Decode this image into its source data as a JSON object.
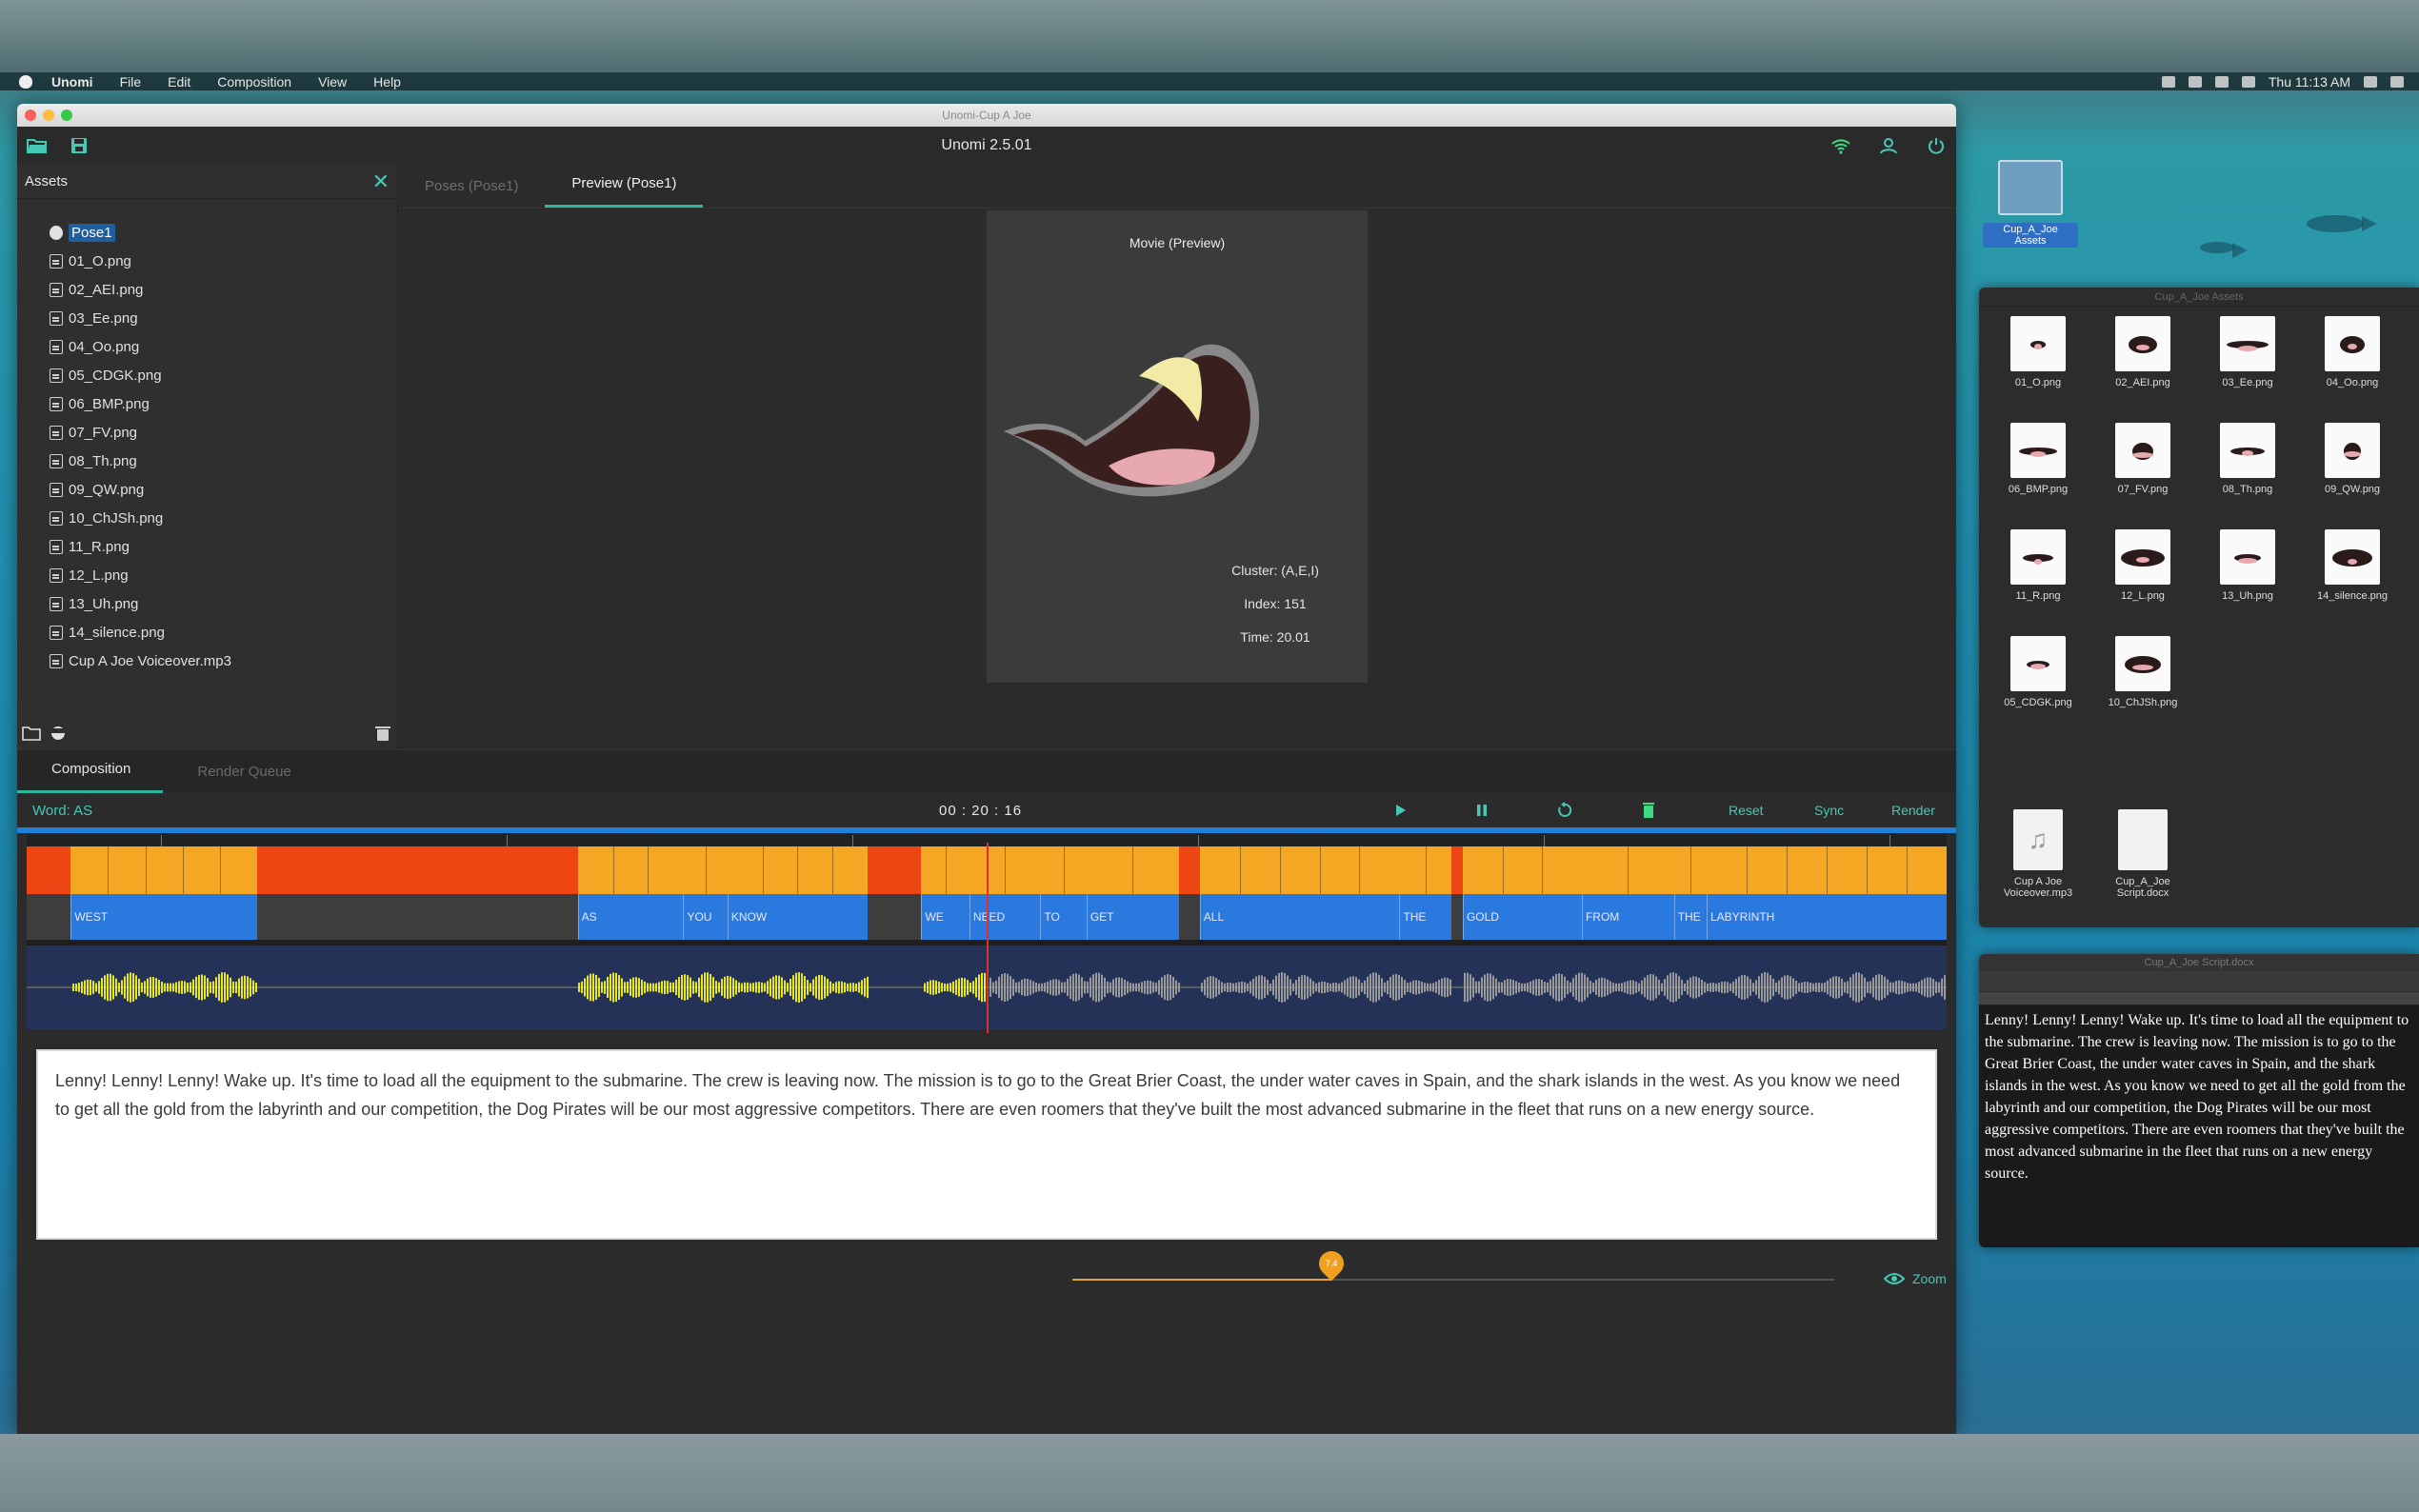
{
  "menubar": {
    "items": [
      "Unomi",
      "File",
      "Edit",
      "Composition",
      "View",
      "Help"
    ],
    "clock": "Thu 11:13 AM"
  },
  "window": {
    "title": "Unomi-Cup A Joe",
    "app_title": "Unomi 2.5.01"
  },
  "assets": {
    "header": "Assets",
    "items": [
      {
        "label": "Pose1",
        "type": "pose",
        "selected": true
      },
      {
        "label": "01_O.png",
        "type": "file"
      },
      {
        "label": "02_AEI.png",
        "type": "file"
      },
      {
        "label": "03_Ee.png",
        "type": "file"
      },
      {
        "label": "04_Oo.png",
        "type": "file"
      },
      {
        "label": "05_CDGK.png",
        "type": "file"
      },
      {
        "label": "06_BMP.png",
        "type": "file"
      },
      {
        "label": "07_FV.png",
        "type": "file"
      },
      {
        "label": "08_Th.png",
        "type": "file"
      },
      {
        "label": "09_QW.png",
        "type": "file"
      },
      {
        "label": "10_ChJSh.png",
        "type": "file"
      },
      {
        "label": "11_R.png",
        "type": "file"
      },
      {
        "label": "12_L.png",
        "type": "file"
      },
      {
        "label": "13_Uh.png",
        "type": "file"
      },
      {
        "label": "14_silence.png",
        "type": "file"
      },
      {
        "label": "Cup A Joe Voiceover.mp3",
        "type": "file"
      }
    ]
  },
  "preview": {
    "tabs": [
      "Poses (Pose1)",
      "Preview (Pose1)"
    ],
    "active_tab": 1,
    "movie_label": "Movie (Preview)",
    "cluster": "Cluster: (A,E,I)",
    "index": "Index: 151",
    "time": "Time: 20.01"
  },
  "composition": {
    "tabs": [
      "Composition",
      "Render Queue"
    ],
    "active_tab": 0,
    "word": "Word: AS",
    "timecode": "00 : 20 : 16",
    "controls": {
      "reset": "Reset",
      "sync": "Sync",
      "render": "Render"
    }
  },
  "timeline": {
    "words": [
      {
        "label": "WEST",
        "start": 0.023,
        "end": 0.12
      },
      {
        "label": "AS",
        "start": 0.287,
        "end": 0.342
      },
      {
        "label": "YOU",
        "start": 0.342,
        "end": 0.365
      },
      {
        "label": "KNOW",
        "start": 0.365,
        "end": 0.438
      },
      {
        "label": "WE",
        "start": 0.466,
        "end": 0.491
      },
      {
        "label": "NEED",
        "start": 0.491,
        "end": 0.528
      },
      {
        "label": "TO",
        "start": 0.528,
        "end": 0.552
      },
      {
        "label": "GET",
        "start": 0.552,
        "end": 0.6
      },
      {
        "label": "ALL",
        "start": 0.611,
        "end": 0.715
      },
      {
        "label": "THE",
        "start": 0.715,
        "end": 0.742
      },
      {
        "label": "GOLD",
        "start": 0.748,
        "end": 0.81
      },
      {
        "label": "FROM",
        "start": 0.81,
        "end": 0.858
      },
      {
        "label": "THE",
        "start": 0.858,
        "end": 0.875
      },
      {
        "label": "LABYRINTH",
        "start": 0.875,
        "end": 1.0
      }
    ],
    "playhead": 0.5
  },
  "script_text": "Lenny! Lenny! Lenny! Wake up. It's time to load all the equipment to the submarine. The crew is leaving now. The mission is to go to the Great Brier Coast, the under water caves in Spain, and the shark islands in the west. As you know we need to get all the gold from the labyrinth and our competition, the Dog Pirates will be our most aggressive competitors. There are even roomers that they've built the most advanced submarine in the fleet that runs on a new energy source.",
  "zoom": {
    "label": "Zoom",
    "knob_value": "7.4",
    "level": 0.34
  },
  "desktop": {
    "folder_label": "Cup_A_Joe Assets",
    "finder_title": "Cup_A_Joe Assets",
    "finder_items": [
      "01_O.png",
      "02_AEI.png",
      "03_Ee.png",
      "04_Oo.png",
      "06_BMP.png",
      "07_FV.png",
      "08_Th.png",
      "09_QW.png",
      "11_R.png",
      "12_L.png",
      "13_Uh.png",
      "14_silence.png",
      "05_CDGK.png",
      "10_ChJSh.png"
    ],
    "finder_files": [
      {
        "line1": "Cup A Joe",
        "line2": "Voiceover.mp3"
      },
      {
        "line1": "Cup_A_Joe",
        "line2": "Script.docx"
      }
    ],
    "doc_title": "Cup_A_Joe Script.docx",
    "doc_text": "Lenny! Lenny! Lenny! Wake up. It's time to load all the equipment to the submarine. The crew is leaving now. The mission is to go to the Great Brier Coast, the under water caves in Spain, and the shark islands in the west. As you know we need to get all the gold from the labyrinth and our competition, the Dog Pirates will be our most aggressive competitors. There are even roomers that they've built the most advanced submarine in the fleet that runs on a new energy source."
  },
  "colors": {
    "accent": "#2fb59e",
    "phoneme_orange": "#f5a623",
    "phoneme_red": "#ee4612",
    "word_blue": "#2a79df",
    "wave_yellow": "#e8e81a",
    "playhead": "#e0302a"
  }
}
